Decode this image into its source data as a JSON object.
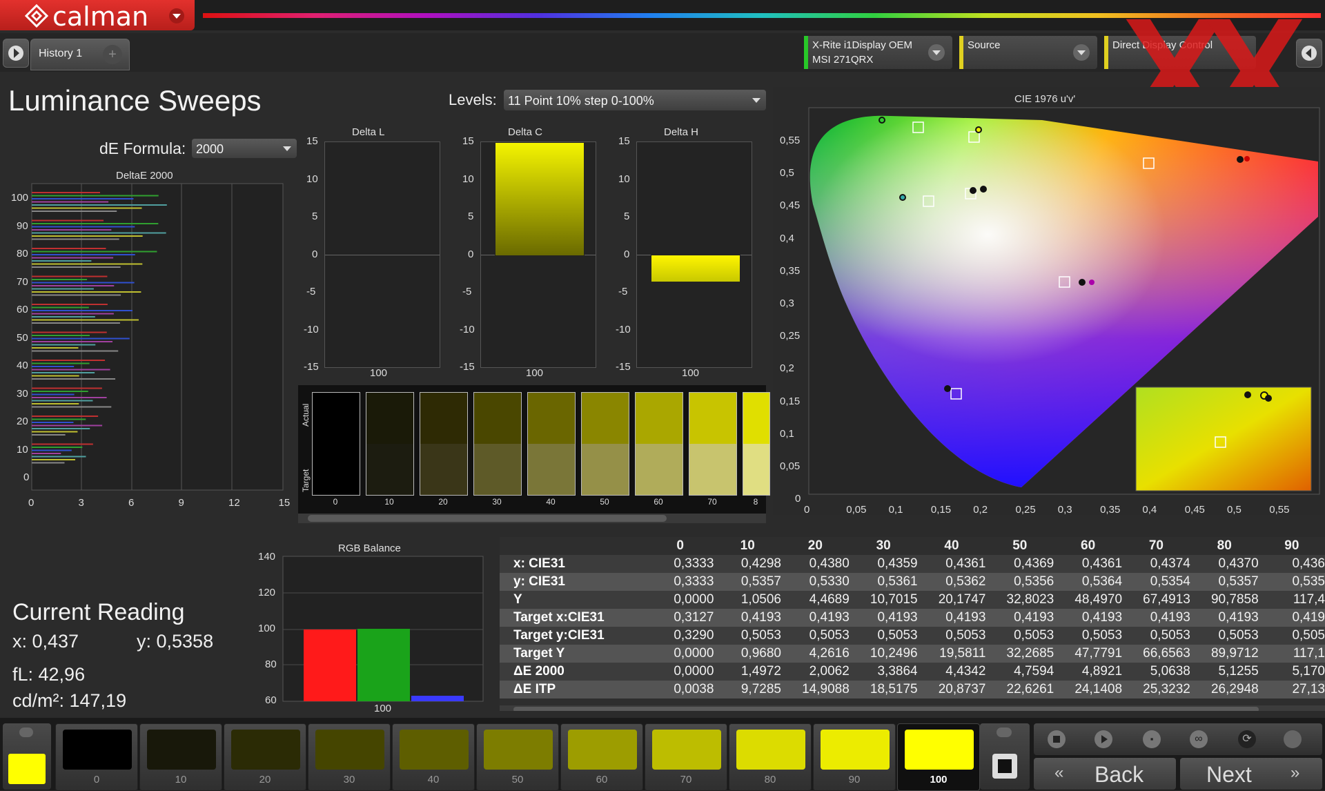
{
  "app": {
    "logo": "calman"
  },
  "tabs": {
    "history": "History 1",
    "add": "+"
  },
  "sources": [
    {
      "line1": "X-Rite i1Display OEM",
      "line2": "MSI 271QRX",
      "color": "#28c828"
    },
    {
      "line1": "Source",
      "line2": "",
      "color": "#e0d020"
    },
    {
      "line1": "Direct Display Control",
      "line2": "",
      "color": "#e0d020"
    }
  ],
  "watermark": "XX",
  "page": {
    "title": "Luminance Sweeps"
  },
  "levels": {
    "label": "Levels:",
    "value": "11 Point 10% step 0-100%"
  },
  "de_formula": {
    "label": "dE Formula:",
    "value": "2000"
  },
  "deltae_chart": {
    "title": "DeltaE 2000",
    "yticks": [
      "100",
      "90",
      "80",
      "70",
      "60",
      "50",
      "40",
      "30",
      "20",
      "10",
      "0"
    ],
    "xticks": [
      "0",
      "3",
      "6",
      "9",
      "12",
      "15"
    ]
  },
  "delta_charts": [
    {
      "title": "Delta L",
      "value": 0,
      "xlabel": "100"
    },
    {
      "title": "Delta C",
      "value": 15,
      "xlabel": "100"
    },
    {
      "title": "Delta H",
      "value": -3.5,
      "xlabel": "100"
    }
  ],
  "delta_yticks": [
    "15",
    "10",
    "5",
    "0",
    "-5",
    "-10",
    "-15"
  ],
  "swatch_row": {
    "actual_label": "Actual",
    "target_label": "Target",
    "labels": [
      "0",
      "10",
      "20",
      "30",
      "40",
      "50",
      "60",
      "70",
      "8"
    ]
  },
  "cie": {
    "title": "CIE 1976 u'v'",
    "yticks": [
      "0,55",
      "0,5",
      "0,45",
      "0,4",
      "0,35",
      "0,3",
      "0,25",
      "0,2",
      "0,15",
      "0,1",
      "0,05",
      "0"
    ],
    "xticks": [
      "0",
      "0,05",
      "0,1",
      "0,15",
      "0,2",
      "0,25",
      "0,3",
      "0,35",
      "0,4",
      "0,45",
      "0,5",
      "0,55"
    ]
  },
  "rgb_balance": {
    "title": "RGB Balance",
    "yticks": [
      "140",
      "120",
      "100",
      "80",
      "60"
    ],
    "xlabel": "100",
    "colors": {
      "red": "#ff1a1a",
      "green": "#1aa31a",
      "blue": "#3a3aff"
    }
  },
  "current_reading": {
    "title": "Current Reading",
    "x": "x: 0,437",
    "y": "y: 0,5358",
    "fl": "fL: 42,96",
    "cdm2": "cd/m²: 147,19"
  },
  "table": {
    "headers": [
      "0",
      "10",
      "20",
      "30",
      "40",
      "50",
      "60",
      "70",
      "80",
      "90"
    ],
    "rows": [
      {
        "label": "x: CIE31",
        "values": [
          "0,3333",
          "0,4298",
          "0,4380",
          "0,4359",
          "0,4361",
          "0,4369",
          "0,4361",
          "0,4374",
          "0,4370",
          "0,436"
        ]
      },
      {
        "label": "y: CIE31",
        "values": [
          "0,3333",
          "0,5357",
          "0,5330",
          "0,5361",
          "0,5362",
          "0,5356",
          "0,5364",
          "0,5354",
          "0,5357",
          "0,535"
        ]
      },
      {
        "label": "Y",
        "values": [
          "0,0000",
          "1,0506",
          "4,4689",
          "10,7015",
          "20,1747",
          "32,8023",
          "48,4970",
          "67,4913",
          "90,7858",
          "117,4"
        ]
      },
      {
        "label": "Target x:CIE31",
        "values": [
          "0,3127",
          "0,4193",
          "0,4193",
          "0,4193",
          "0,4193",
          "0,4193",
          "0,4193",
          "0,4193",
          "0,4193",
          "0,419"
        ]
      },
      {
        "label": "Target y:CIE31",
        "values": [
          "0,3290",
          "0,5053",
          "0,5053",
          "0,5053",
          "0,5053",
          "0,5053",
          "0,5053",
          "0,5053",
          "0,5053",
          "0,505"
        ]
      },
      {
        "label": "Target Y",
        "values": [
          "0,0000",
          "0,9680",
          "4,2616",
          "10,2496",
          "19,5811",
          "32,2685",
          "47,7791",
          "66,6563",
          "89,9712",
          "117,1"
        ]
      },
      {
        "label": "ΔE 2000",
        "values": [
          "0,0000",
          "1,4972",
          "2,0062",
          "3,3864",
          "4,4342",
          "4,7594",
          "4,8921",
          "5,0638",
          "5,1255",
          "5,170"
        ]
      },
      {
        "label": "ΔE ITP",
        "values": [
          "0,0038",
          "9,7285",
          "14,9088",
          "18,5175",
          "20,8737",
          "22,6261",
          "24,1408",
          "25,3232",
          "26,2948",
          "27,13"
        ]
      }
    ]
  },
  "bottom_strip": {
    "labels": [
      "0",
      "10",
      "20",
      "30",
      "40",
      "50",
      "60",
      "70",
      "80",
      "90",
      "100"
    ],
    "colors": [
      "#000000",
      "#18180a",
      "#2b2b05",
      "#454500",
      "#5e5e00",
      "#7d7d00",
      "#9d9d00",
      "#bdbd00",
      "#dcdc00",
      "#ecec00",
      "#ffff00"
    ],
    "selected": "100"
  },
  "nav": {
    "back": "Back",
    "next": "Next"
  }
}
